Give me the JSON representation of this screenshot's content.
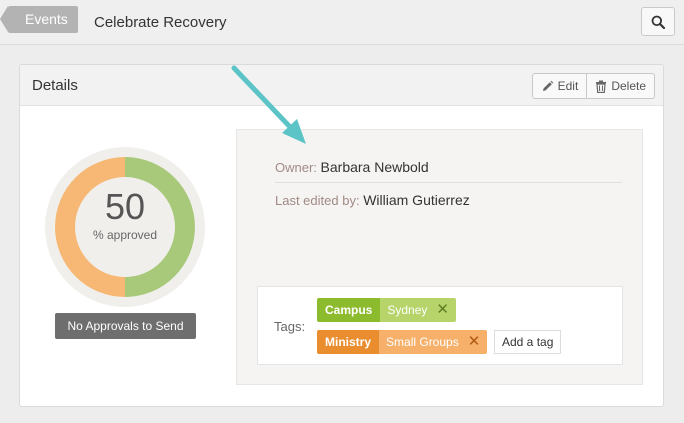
{
  "topbar": {
    "back_label": "Events",
    "title": "Celebrate Recovery",
    "search_icon": "search-icon"
  },
  "details": {
    "title": "Details",
    "edit_label": "Edit",
    "delete_label": "Delete"
  },
  "approval": {
    "value": "50",
    "label": "% approved",
    "percent_approved": 50,
    "colors": {
      "approved": "#a8c97a",
      "pending": "#f6b874",
      "track": "#f1efec"
    },
    "button_label": "No Approvals to Send"
  },
  "info": {
    "owner_label": "Owner:",
    "owner_value": "Barbara Newbold",
    "edited_label": "Last edited by:",
    "edited_value": "William Gutierrez"
  },
  "tags": {
    "label": "Tags:",
    "items": [
      {
        "category": "Campus",
        "name": "Sydney"
      },
      {
        "category": "Ministry",
        "name": "Small Groups"
      }
    ],
    "add_label": "Add a tag"
  },
  "annotation": {
    "arrow_color": "#5cc4c6"
  }
}
